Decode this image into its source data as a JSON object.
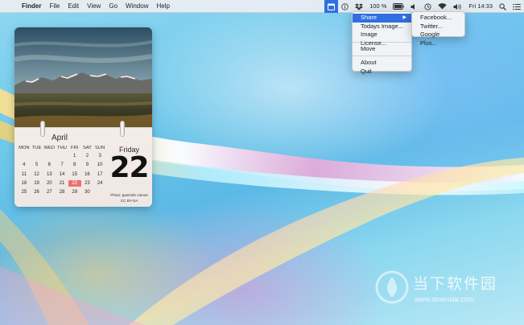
{
  "menubar": {
    "apple_glyph": "",
    "app_name": "Finder",
    "menus": [
      "File",
      "Edit",
      "View",
      "Go",
      "Window",
      "Help"
    ],
    "status": {
      "battery_text": "100 %",
      "clock": "Fri 14:33"
    },
    "icons": [
      "calendar-app-icon",
      "info-icon",
      "dropbox-icon",
      "battery-icon",
      "volume-icon",
      "time-machine-icon",
      "wifi-icon",
      "speaker-icon",
      "spotlight-icon",
      "notification-center-icon"
    ]
  },
  "main_menu": {
    "items": [
      {
        "label": "Share",
        "submenu_arrow": "▶"
      },
      {
        "label": "Todays Image..."
      },
      {
        "label": "Image License..."
      },
      {
        "label": "Move"
      },
      {
        "label": "About"
      },
      {
        "label": "Quit"
      }
    ]
  },
  "share_menu": {
    "items": [
      "Facebook...",
      "Twitter...",
      "Google Plus..."
    ]
  },
  "calendar": {
    "month": "April",
    "weekday_headers": [
      "MON",
      "TUE",
      "WED",
      "THU",
      "FRI",
      "SAT",
      "SUN"
    ],
    "weeks": [
      [
        "",
        "",
        "",
        "",
        "1",
        "2",
        "3"
      ],
      [
        "4",
        "5",
        "6",
        "7",
        "8",
        "9",
        "10"
      ],
      [
        "11",
        "12",
        "13",
        "14",
        "15",
        "16",
        "17"
      ],
      [
        "18",
        "19",
        "20",
        "21",
        "22",
        "23",
        "24"
      ],
      [
        "25",
        "26",
        "27",
        "28",
        "29",
        "30",
        ""
      ]
    ],
    "today": "22",
    "weekday": "Friday",
    "day_number": "22",
    "photo_credit_line1": "Photo: gwenole camus",
    "photo_credit_line2": "CC BY-SA",
    "today_color": "#ef6f6f"
  },
  "watermark": {
    "text": "当下软件园",
    "url": "www.downxia.com"
  },
  "colors": {
    "highlight": "#2f6fe0"
  }
}
